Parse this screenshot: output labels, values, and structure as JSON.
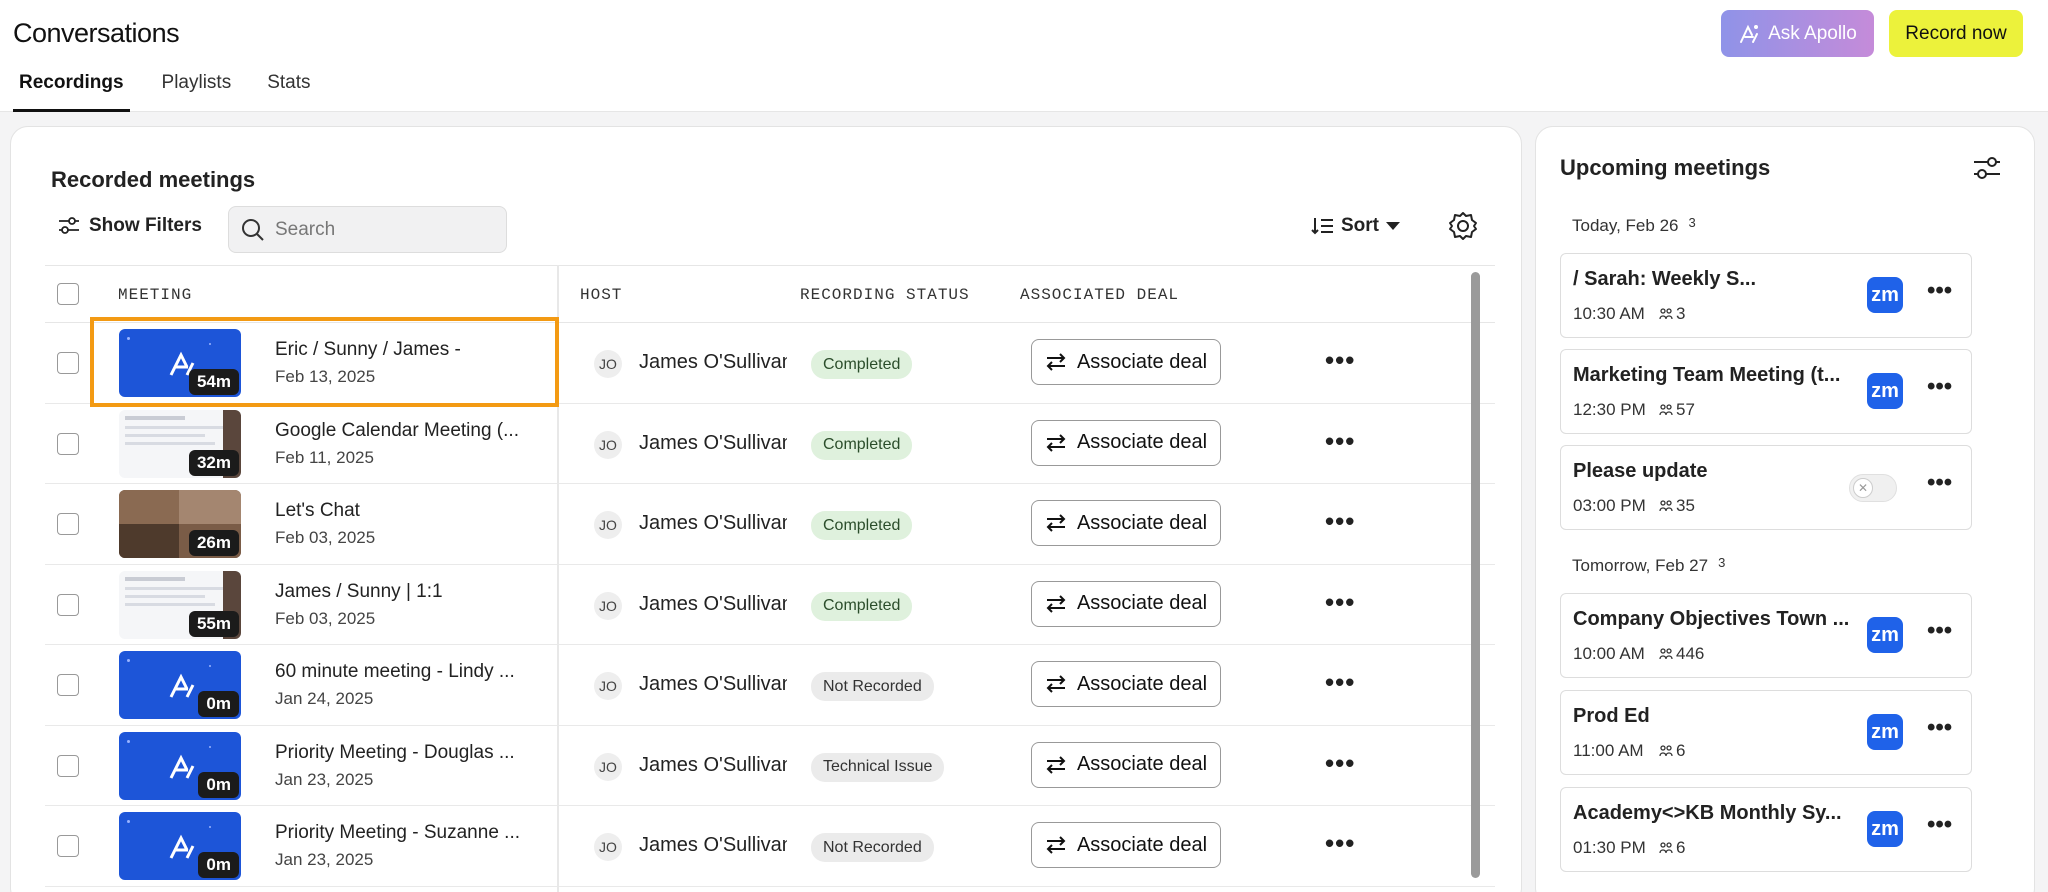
{
  "header": {
    "title": "Conversations",
    "tabs": [
      {
        "label": "Recordings",
        "active": true
      },
      {
        "label": "Playlists",
        "active": false
      },
      {
        "label": "Stats",
        "active": false
      }
    ],
    "ask_label": "Ask Apollo",
    "record_label": "Record now"
  },
  "main": {
    "title": "Recorded meetings",
    "show_filters": "Show Filters",
    "search_placeholder": "Search",
    "sort_label": "Sort",
    "columns": [
      "MEETING",
      "HOST",
      "RECORDING STATUS",
      "ASSOCIATED DEAL"
    ],
    "associate_label": "Associate deal",
    "rows": [
      {
        "title": "Eric / Sunny / James -",
        "date": "Feb 13, 2025",
        "duration": "54m",
        "thumb": "blue",
        "host_initials": "JO",
        "host": "James O'Sullivan",
        "status": "Completed",
        "status_kind": "ok"
      },
      {
        "title": "Google Calendar Meeting (...",
        "date": "Feb 11, 2025",
        "duration": "32m",
        "thumb": "shot",
        "host_initials": "JO",
        "host": "James O'Sullivan",
        "status": "Completed",
        "status_kind": "ok"
      },
      {
        "title": "Let's Chat",
        "date": "Feb 03, 2025",
        "duration": "26m",
        "thumb": "cam",
        "host_initials": "JO",
        "host": "James O'Sullivan",
        "status": "Completed",
        "status_kind": "ok"
      },
      {
        "title": "James / Sunny | 1:1",
        "date": "Feb 03, 2025",
        "duration": "55m",
        "thumb": "shot",
        "host_initials": "JO",
        "host": "James O'Sullivan",
        "status": "Completed",
        "status_kind": "ok"
      },
      {
        "title": "60 minute meeting - Lindy ...",
        "date": "Jan 24, 2025",
        "duration": "0m",
        "thumb": "blue",
        "host_initials": "JO",
        "host": "James O'Sullivan",
        "status": "Not Recorded",
        "status_kind": "grey"
      },
      {
        "title": "Priority Meeting - Douglas ...",
        "date": "Jan 23, 2025",
        "duration": "0m",
        "thumb": "blue",
        "host_initials": "JO",
        "host": "James O'Sullivan",
        "status": "Technical Issue",
        "status_kind": "grey"
      },
      {
        "title": "Priority Meeting - Suzanne ...",
        "date": "Jan 23, 2025",
        "duration": "0m",
        "thumb": "blue",
        "host_initials": "JO",
        "host": "James O'Sullivan",
        "status": "Not Recorded",
        "status_kind": "grey"
      }
    ]
  },
  "side": {
    "title": "Upcoming meetings",
    "days": [
      {
        "label": "Today, Feb 26",
        "count": "3",
        "meetings": [
          {
            "title": "/ Sarah: Weekly S...",
            "time": "10:30 AM",
            "attendees": "3",
            "kind": "zoom"
          },
          {
            "title": "Marketing Team Meeting (t...",
            "time": "12:30 PM",
            "attendees": "57",
            "kind": "zoom"
          },
          {
            "title": "Please update",
            "time": "03:00 PM",
            "attendees": "35",
            "kind": "toggle"
          }
        ]
      },
      {
        "label": "Tomorrow, Feb 27",
        "count": "3",
        "meetings": [
          {
            "title": "Company Objectives Town ...",
            "time": "10:00 AM",
            "attendees": "446",
            "kind": "zoom"
          },
          {
            "title": "Prod Ed",
            "time": "11:00 AM",
            "attendees": "6",
            "kind": "zoom"
          },
          {
            "title": "Academy<>KB Monthly Sy...",
            "time": "01:30 PM",
            "attendees": "6",
            "kind": "zoom"
          }
        ]
      }
    ],
    "zoom_label": "zm",
    "more_label": "•••"
  },
  "colors": {
    "ask_gradient_start": "#8f93e8",
    "ask_gradient_end": "#c58bd9",
    "record": "#ecf23b",
    "highlight": "#f39a13",
    "zoom": "#1f62e9",
    "thumb_blue": "#1d55d8"
  }
}
